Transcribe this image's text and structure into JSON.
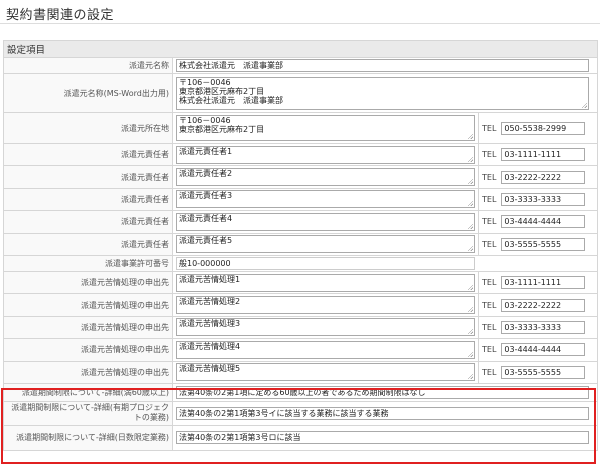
{
  "page": {
    "title": "契約書関連の設定"
  },
  "section": {
    "header": "設定項目"
  },
  "tel_label": "TEL",
  "rows": [
    {
      "label": "派遣元名称",
      "value": "株式会社派遣元　派遣事業部"
    },
    {
      "label": "派遣元名称(MS-Word出力用)",
      "lines": [
        "〒106－0046",
        "東京都港区元麻布2丁目",
        "株式会社派遣元　派遣事業部"
      ]
    },
    {
      "label": "派遣元所在地",
      "lines": [
        "〒106－0046",
        "東京都港区元麻布2丁目"
      ],
      "tel": "050-5538-2999"
    },
    {
      "label": "派遣元責任者",
      "value": "派遣元責任者1",
      "tel": "03-1111-1111"
    },
    {
      "label": "派遣元責任者",
      "value": "派遣元責任者2",
      "tel": "03-2222-2222"
    },
    {
      "label": "派遣元責任者",
      "value": "派遣元責任者3",
      "tel": "03-3333-3333"
    },
    {
      "label": "派遣元責任者",
      "value": "派遣元責任者4",
      "tel": "03-4444-4444"
    },
    {
      "label": "派遣元責任者",
      "value": "派遣元責任者5",
      "tel": "03-5555-5555"
    },
    {
      "label": "派遣事業許可番号",
      "value": "般10-000000"
    },
    {
      "label": "派遣元苦情処理の申出先",
      "value": "派遣元苦情処理1",
      "tel": "03-1111-1111"
    },
    {
      "label": "派遣元苦情処理の申出先",
      "value": "派遣元苦情処理2",
      "tel": "03-2222-2222"
    },
    {
      "label": "派遣元苦情処理の申出先",
      "value": "派遣元苦情処理3",
      "tel": "03-3333-3333"
    },
    {
      "label": "派遣元苦情処理の申出先",
      "value": "派遣元苦情処理4",
      "tel": "03-4444-4444"
    },
    {
      "label": "派遣元苦情処理の申出先",
      "value": "派遣元苦情処理5",
      "tel": "03-5555-5555"
    },
    {
      "label": "派遣期間制限について-詳細(満60歳以上)",
      "value": "法第40条の2第1項に定める60歳以上の者であるため期間制限はなし"
    },
    {
      "label": "派遣期間制限について-詳細(有期プロジェクトの業務)",
      "value": "法第40条の2第1項第3号イに該当する業務に該当する業務"
    },
    {
      "label": "派遣期間制限について-詳細(日数限定業務)",
      "value": "法第40条の2第1項第3号ロに該当"
    }
  ],
  "colors": {
    "highlight": "#e02020",
    "header_bg": "#eaeaea"
  }
}
